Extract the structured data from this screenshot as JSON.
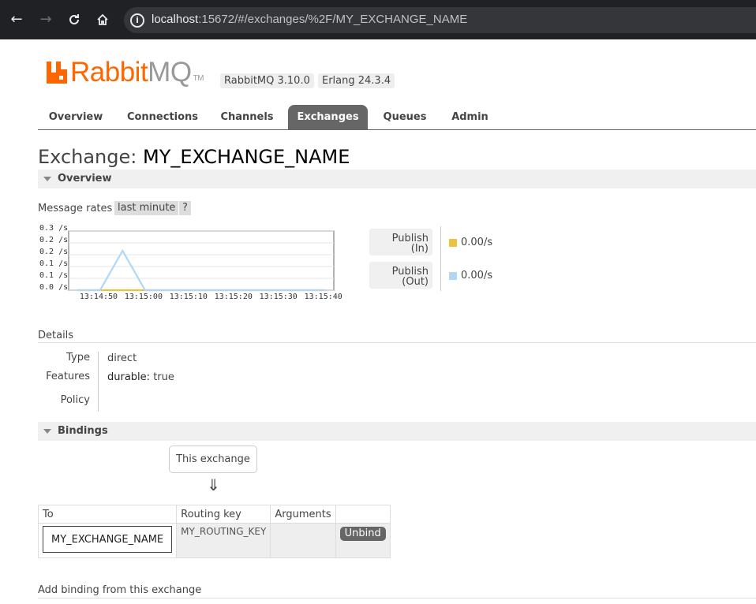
{
  "browser": {
    "url_host": "localhost",
    "url_rest": ":15672/#/exchanges/%2F/MY_EXCHANGE_NAME"
  },
  "header": {
    "logo_rabbit": "Rabbit",
    "logo_mq": "MQ",
    "logo_tm": "TM",
    "version_rabbit": "RabbitMQ 3.10.0",
    "version_erlang": "Erlang 24.3.4",
    "brand_color": "#ff6600"
  },
  "tabs": [
    "Overview",
    "Connections",
    "Channels",
    "Exchanges",
    "Queues",
    "Admin"
  ],
  "active_tab": "Exchanges",
  "page": {
    "title_prefix": "Exchange:",
    "title_name": "MY_EXCHANGE_NAME"
  },
  "overview": {
    "section_label": "Overview",
    "rates_label": "Message rates",
    "rates_period": "last minute",
    "help": "?"
  },
  "chart_data": {
    "type": "line",
    "y_ticks": [
      "0.3 /s",
      "0.2 /s",
      "0.2 /s",
      "0.1 /s",
      "0.1 /s",
      "0.0 /s"
    ],
    "x_ticks": [
      "13:14:50",
      "13:15:00",
      "13:15:10",
      "13:15:20",
      "13:15:30",
      "13:15:40"
    ],
    "ylim": [
      0,
      0.3
    ],
    "grid": true,
    "series": [
      {
        "name": "Publish (In)",
        "color": "#edc240",
        "x": [
          "13:14:45",
          "13:14:50",
          "13:14:55",
          "13:15:00",
          "13:15:05",
          "13:15:40"
        ],
        "values": [
          0,
          0,
          0,
          0,
          0,
          0
        ]
      },
      {
        "name": "Publish (Out)",
        "color": "#afd8f8",
        "x": [
          "13:14:45",
          "13:14:50",
          "13:14:55",
          "13:15:00",
          "13:15:05",
          "13:15:40"
        ],
        "values": [
          0,
          0,
          0.2,
          0,
          0,
          0
        ]
      }
    ]
  },
  "legend": [
    {
      "label_line1": "Publish",
      "label_line2": "(In)",
      "value": "0.00/s",
      "color": "#edc240"
    },
    {
      "label_line1": "Publish",
      "label_line2": "(Out)",
      "value": "0.00/s",
      "color": "#afd8f8"
    }
  ],
  "details": {
    "section_label": "Details",
    "type_label": "Type",
    "type_value": "direct",
    "features_label": "Features",
    "features_key": "durable:",
    "features_value": "true",
    "policy_label": "Policy"
  },
  "bindings": {
    "section_label": "Bindings",
    "this_exchange": "This exchange",
    "arrow": "⇓",
    "columns": [
      "To",
      "Routing key",
      "Arguments",
      ""
    ],
    "rows": [
      {
        "to": "MY_EXCHANGE_NAME",
        "routing_key": "MY_ROUTING_KEY",
        "arguments": "",
        "action": "Unbind"
      }
    ]
  },
  "add_binding": {
    "label": "Add binding from this exchange"
  }
}
